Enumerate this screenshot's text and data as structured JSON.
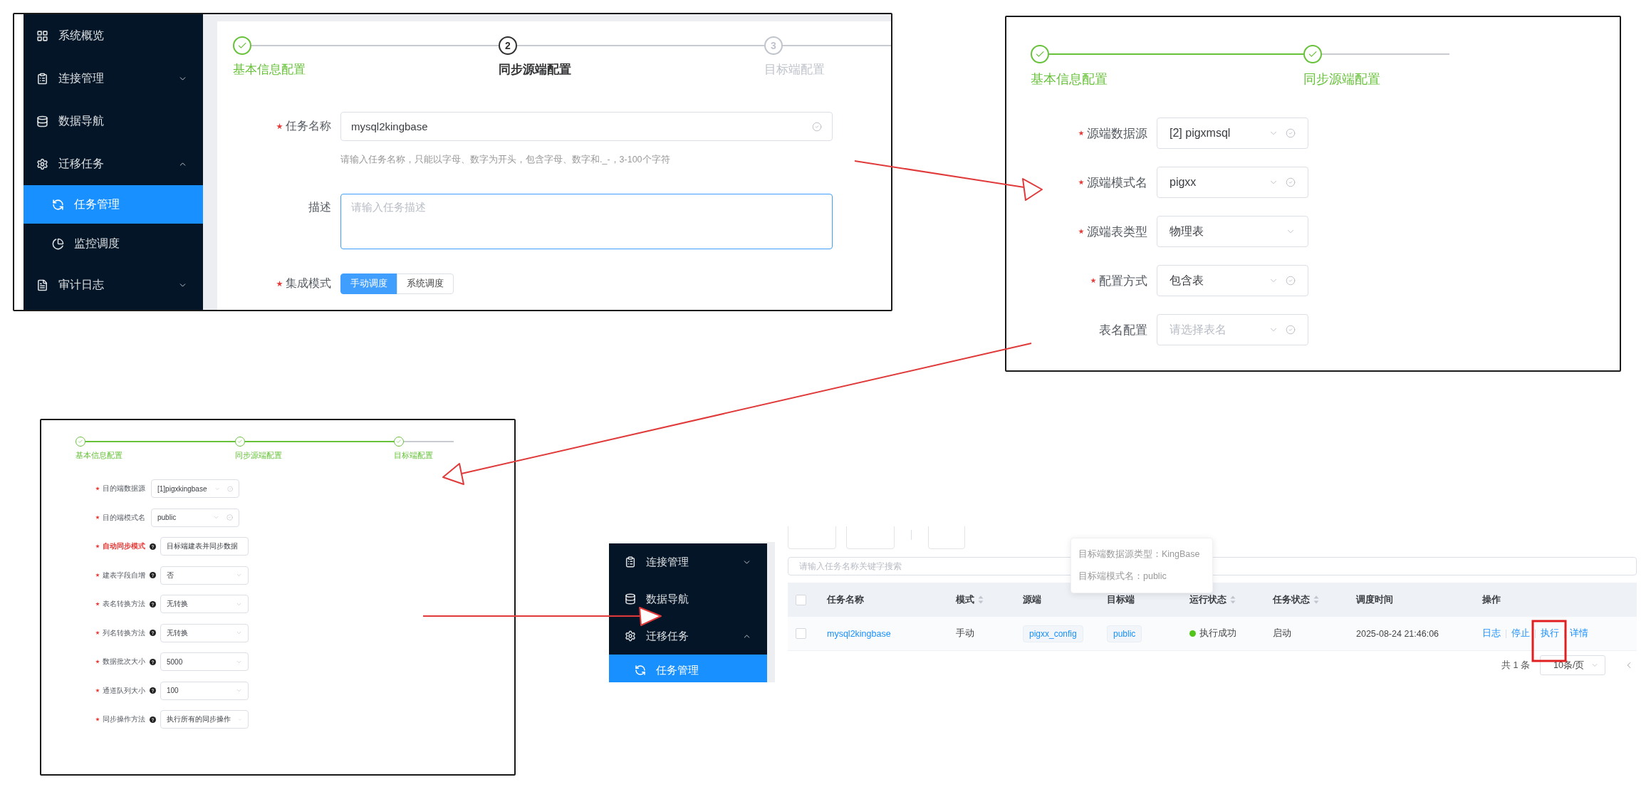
{
  "config_basic": {
    "sidebar": [
      {
        "label": "系统概览",
        "selected": false
      },
      {
        "label": "连接管理",
        "expanded": false,
        "selected": false
      },
      {
        "label": "数据导航",
        "selected": false
      },
      {
        "label": "迁移任务",
        "expanded": true,
        "selected": false,
        "children": [
          {
            "label": "任务管理",
            "selected": true
          },
          {
            "label": "监控调度",
            "selected": false
          }
        ]
      },
      {
        "label": "审计日志",
        "expanded": false,
        "selected": false
      }
    ],
    "steps": [
      {
        "title": "基本信息配置",
        "done": true,
        "current": false
      },
      {
        "number": "2",
        "title": "同步源端配置",
        "done": false,
        "current": true
      },
      {
        "number": "3",
        "title": "目标端配置",
        "done": false,
        "current": false
      }
    ],
    "fields": [
      {
        "kind": "input",
        "label": "任务名称",
        "required": true,
        "value": "mysql2kingbase",
        "validated": true,
        "hint": "请输入任务名称，只能以字母、数字为开头，包含字母、数字和._-，3-100个字符"
      },
      {
        "kind": "textarea",
        "label": "描述",
        "required": false,
        "placeholder": "请输入任务描述",
        "focused": true
      },
      {
        "kind": "segmented",
        "label": "集成模式",
        "required": true,
        "options": [
          {
            "label": "手动调度",
            "selected": true
          },
          {
            "label": "系统调度",
            "selected": false
          }
        ]
      }
    ]
  },
  "config_source": {
    "steps": [
      {
        "title": "基本信息配置",
        "done": true,
        "current": false
      },
      {
        "title": "同步源端配置",
        "done": true,
        "current": false
      }
    ],
    "fields": [
      {
        "label": "源端数据源",
        "required": true,
        "value": "[2] pigxmsql",
        "validated": true
      },
      {
        "label": "源端模式名",
        "required": true,
        "value": "pigxx",
        "validated": true
      },
      {
        "label": "源端表类型",
        "required": true,
        "value": "物理表",
        "validated": false
      },
      {
        "label": "配置方式",
        "required": true,
        "value": "包含表",
        "validated": true
      },
      {
        "label": "表名配置",
        "required": false,
        "placeholder": "请选择表名",
        "validated": true
      }
    ]
  },
  "config_target": {
    "steps": [
      {
        "title": "基本信息配置",
        "done": true,
        "current": false
      },
      {
        "title": "同步源端配置",
        "done": true,
        "current": false
      },
      {
        "title": "目标端配置",
        "done": true,
        "current": false
      }
    ],
    "fields": [
      {
        "label": "目的端数据源",
        "required": true,
        "help": false,
        "emphasized": false,
        "value": "[1]pigxkingbase",
        "validated": true
      },
      {
        "label": "目的端模式名",
        "required": true,
        "help": false,
        "emphasized": false,
        "value": "public",
        "validated": true
      },
      {
        "label": "自动同步模式",
        "required": true,
        "help": true,
        "emphasized": true,
        "value": "目标端建表并同步数据",
        "validated": false
      },
      {
        "label": "建表字段自增",
        "required": true,
        "help": true,
        "emphasized": false,
        "value": "否",
        "validated": false
      },
      {
        "label": "表名转换方法",
        "required": true,
        "help": true,
        "emphasized": false,
        "value": "无转换",
        "validated": false
      },
      {
        "label": "列名转换方法",
        "required": true,
        "help": true,
        "emphasized": false,
        "value": "无转换",
        "validated": false
      },
      {
        "label": "数据批次大小",
        "required": true,
        "help": true,
        "emphasized": false,
        "value": "5000",
        "validated": false
      },
      {
        "label": "通道队列大小",
        "required": true,
        "help": true,
        "emphasized": false,
        "value": "100",
        "validated": false
      },
      {
        "label": "同步操作方法",
        "required": true,
        "help": true,
        "emphasized": false,
        "value": "执行所有的同步操作",
        "validated": false
      }
    ]
  },
  "task_list": {
    "sidebar": [
      {
        "label": "连接管理",
        "expanded": false,
        "selected": false
      },
      {
        "label": "数据导航",
        "selected": false
      },
      {
        "label": "迁移任务",
        "expanded": true,
        "selected": false,
        "children": [
          {
            "label": "任务管理",
            "selected": true
          }
        ]
      }
    ],
    "search": {
      "placeholder": "请输入任务名称关键字搜索"
    },
    "header_checked": false,
    "columns": [
      {
        "label": "任务名称",
        "sortable": false
      },
      {
        "label": "模式",
        "sortable": true
      },
      {
        "label": "源端",
        "sortable": false
      },
      {
        "label": "目标端",
        "sortable": false
      },
      {
        "label": "运行状态",
        "sortable": true
      },
      {
        "label": "任务状态",
        "sortable": true
      },
      {
        "label": "调度时间",
        "sortable": false
      },
      {
        "label": "操作",
        "sortable": false
      }
    ],
    "rows": [
      {
        "checked": false,
        "name": "mysql2kingbase",
        "mode": "手动",
        "source": "pigxx_config",
        "target": "public",
        "run_status": {
          "label": "执行成功",
          "color": "#52c41a"
        },
        "task_status": "启动",
        "schedule_time": "2025-08-24 21:46:06",
        "actions": [
          "日志",
          "停止",
          "执行",
          "详情"
        ]
      }
    ],
    "tooltip": [
      "目标端数据源类型：KingBase",
      "目标端模式名：public"
    ],
    "pagination": {
      "total": "共 1 条",
      "page_size": "10条/页"
    }
  }
}
